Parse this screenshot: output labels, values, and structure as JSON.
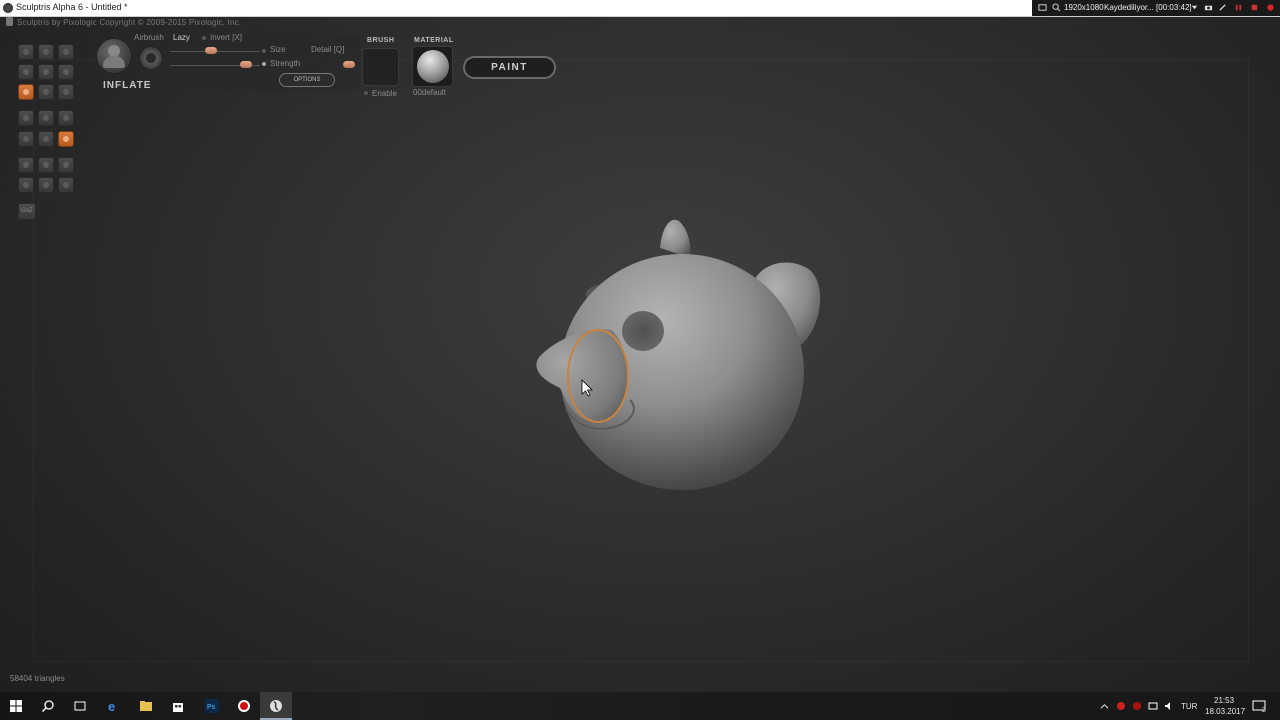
{
  "window": {
    "title": "Sculptris Alpha 6 - Untitled *",
    "copyright": "Sculptris by Pixologic    Copyright © 2009-2015 Pixologic, Inc."
  },
  "recorder": {
    "resolution": "1920x1080",
    "status": "Kaydediliyor... [00:03:42]"
  },
  "brush_panel": {
    "tool_name": "INFLATE",
    "airbrush_label": "Airbrush",
    "lazy_label": "Lazy",
    "invert_label": "Invert [X]",
    "size_label": "Size",
    "strength_label": "Strength",
    "detail_label": "Detail [Q]",
    "options_label": "OPTIONS",
    "brush_header": "BRUSH",
    "enable_label": "Enable",
    "material_header": "MATERIAL",
    "material_name": "00default",
    "paint_label": "PAINT"
  },
  "toolbar": {
    "goz_label": "GoZ",
    "tools": [
      {
        "name": "draw-tool-icon",
        "active": false
      },
      {
        "name": "rotate-tool-icon",
        "active": false
      },
      {
        "name": "crease-tool-icon",
        "active": false
      },
      {
        "name": "flatten-tool-icon",
        "active": false
      },
      {
        "name": "smooth-tool-icon",
        "active": false
      },
      {
        "name": "grab-tool-icon",
        "active": false
      },
      {
        "name": "inflate-tool-icon",
        "active": true
      },
      {
        "name": "pinch-tool-icon",
        "active": false
      },
      {
        "name": "scale-tool-icon",
        "active": false
      },
      {
        "name": "reduce-brush-icon",
        "active": false
      },
      {
        "name": "reduce-selected-icon",
        "active": false
      },
      {
        "name": "subdivide-icon",
        "active": false
      },
      {
        "name": "wireframe-icon",
        "active": false
      },
      {
        "name": "mirror-icon",
        "active": false
      },
      {
        "name": "symmetry-icon",
        "active": true
      },
      {
        "name": "sphere-icon",
        "active": false
      },
      {
        "name": "plane-icon",
        "active": false
      },
      {
        "name": "mask-icon",
        "active": false
      },
      {
        "name": "hide-icon",
        "active": false
      },
      {
        "name": "save-icon",
        "active": false
      },
      {
        "name": "open-icon",
        "active": false
      }
    ]
  },
  "status": {
    "triangles": "58404 triangles"
  },
  "taskbar": {
    "language": "TUR",
    "time": "21:53",
    "date": "18.03.2017",
    "notifications": "2",
    "apps": [
      "start",
      "search",
      "task-view",
      "edge",
      "file-explorer",
      "store",
      "photoshop",
      "recorder",
      "sculptris"
    ]
  },
  "colors": {
    "accent": "#c8702e",
    "brush_ring": "#c8843c",
    "model": "#8c8c8c"
  }
}
